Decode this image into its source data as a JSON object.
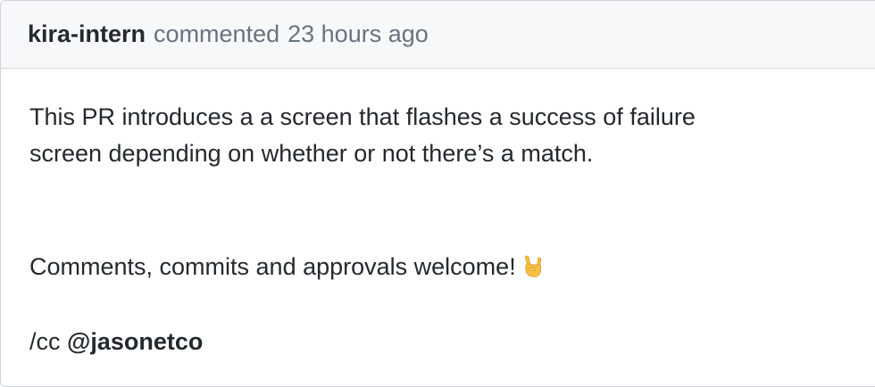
{
  "comment": {
    "author": "kira-intern",
    "action": "commented",
    "timestamp": "23 hours ago",
    "body": {
      "line1": "This PR introduces a a screen that flashes a success of failure",
      "line2": "screen depending on whether or not there’s a match.",
      "welcome_text": "Comments, commits and approvals welcome!",
      "welcome_emoji": "sign-of-the-horns-emoji",
      "cc_prefix": "/cc",
      "mention": "@jasonetco"
    }
  }
}
